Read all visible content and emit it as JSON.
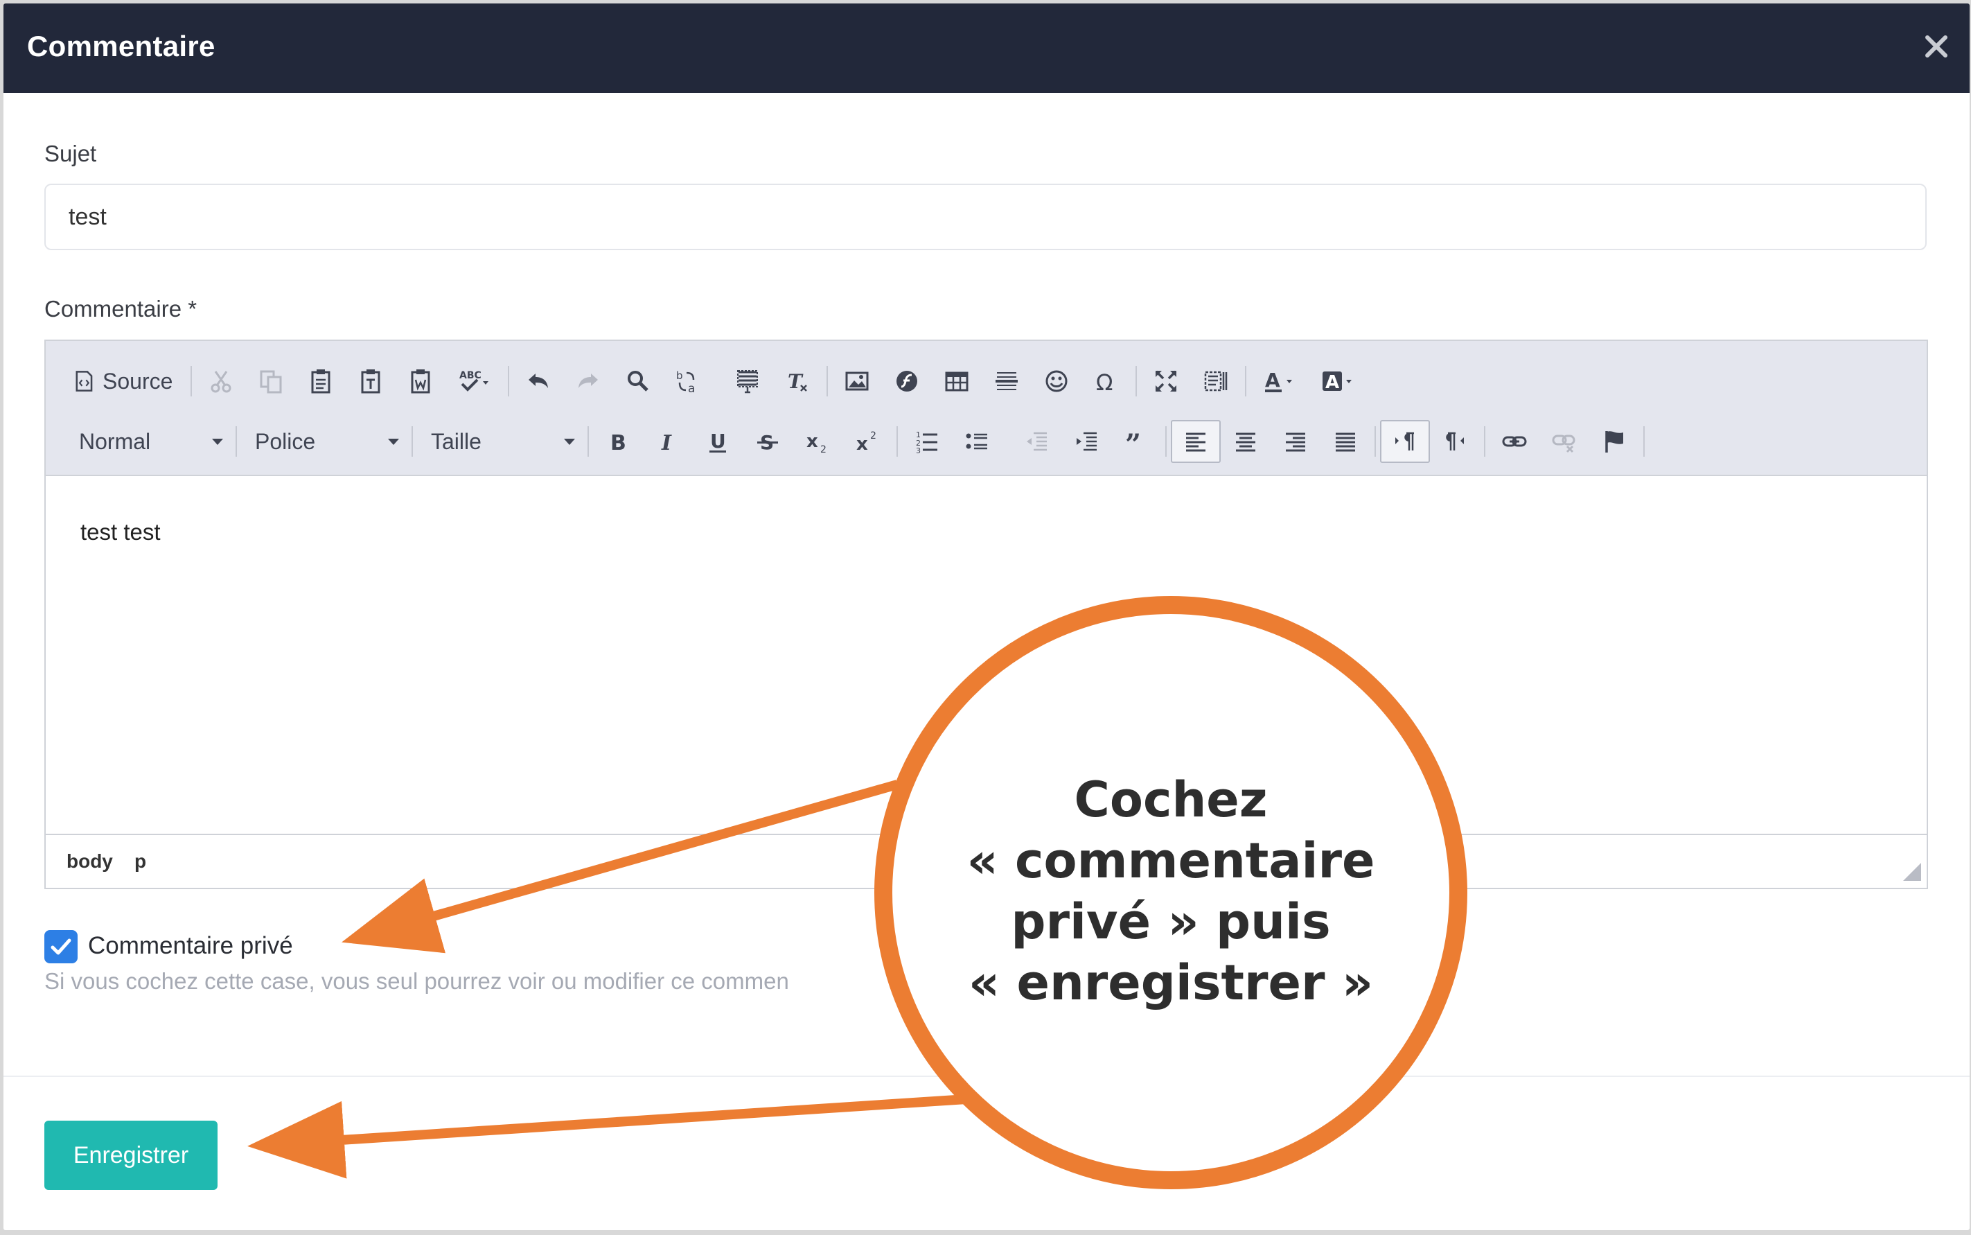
{
  "modal": {
    "title": "Commentaire",
    "close_icon": "close-icon"
  },
  "form": {
    "subject_label": "Sujet",
    "subject_value": "test",
    "comment_label": "Commentaire *",
    "private_label": "Commentaire privé",
    "private_checked": true,
    "help_text": "Si vous cochez cette case, vous seul pourrez voir ou modifier ce commen",
    "save_label": "Enregistrer"
  },
  "editor": {
    "source_label": "Source",
    "format_value": "Normal",
    "font_value": "Police",
    "size_value": "Taille",
    "content": "test test",
    "path": [
      "body",
      "p"
    ],
    "toolbar_row1_icons": [
      "source-icon",
      "cut-icon",
      "copy-icon",
      "paste-icon",
      "paste-text-icon",
      "paste-word-icon",
      "spellcheck-icon",
      "undo-icon",
      "redo-icon",
      "find-icon",
      "replace-icon",
      "select-all-icon",
      "remove-format-icon",
      "image-icon",
      "flash-icon",
      "table-icon",
      "horizontal-rule-icon",
      "smiley-icon",
      "special-char-icon",
      "maximize-icon",
      "show-blocks-icon",
      "text-color-icon",
      "bg-color-icon"
    ],
    "toolbar_row2_icons": [
      "bold-icon",
      "italic-icon",
      "underline-icon",
      "strike-icon",
      "subscript-icon",
      "superscript-icon",
      "numbered-list-icon",
      "bulleted-list-icon",
      "outdent-icon",
      "indent-icon",
      "blockquote-icon",
      "align-left-icon",
      "align-center-icon",
      "align-right-icon",
      "justify-icon",
      "ltr-icon",
      "rtl-icon",
      "link-icon",
      "unlink-icon",
      "anchor-icon"
    ]
  },
  "annotation": {
    "line1": "Cochez",
    "line2": "« commentaire",
    "line3": "privé » puis",
    "line4": "« enregistrer »",
    "color": "#ec7d32"
  },
  "colors": {
    "header_bg": "#22283a",
    "save_button": "#20b9b0",
    "checkbox": "#2d7fe5"
  }
}
